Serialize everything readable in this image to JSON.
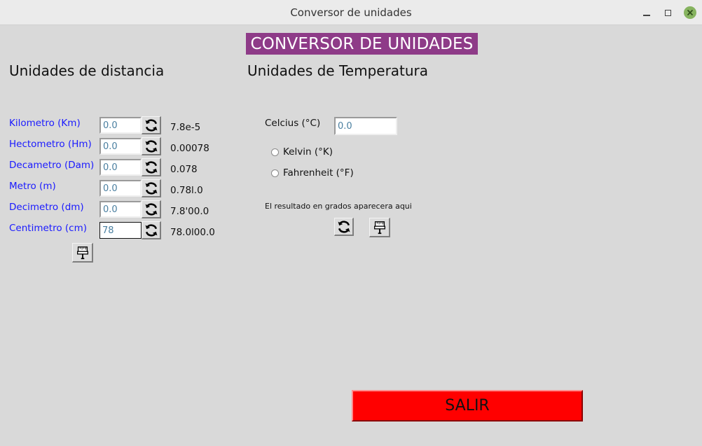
{
  "window": {
    "title": "Conversor de unidades"
  },
  "banner": "CONVERSOR DE UNIDADES",
  "distance": {
    "title": "Unidades de distancia",
    "rows": [
      {
        "label": "Kilometro (Km)",
        "value": "0.0",
        "result": "7.8e-5"
      },
      {
        "label": "Hectometro (Hm)",
        "value": "0.0",
        "result": "0.00078"
      },
      {
        "label": "Decametro (Dam)",
        "value": "0.0",
        "result": "0.078"
      },
      {
        "label": "Metro (m)",
        "value": "0.0",
        "result": "0.78l.0"
      },
      {
        "label": "Decimetro (dm)",
        "value": "0.0",
        "result": "7.8'00.0"
      },
      {
        "label": "Centimetro (cm)",
        "value": "78",
        "result": "78.0l00.0"
      }
    ]
  },
  "temperature": {
    "title": "Unidades de Temperatura",
    "celsius_label": "Celcius (°C)",
    "celsius_value": "0.0",
    "options": [
      "Kelvin (°K)",
      "Fahrenheit (°F)"
    ],
    "result_note": "El resultado en grados aparecera aqui"
  },
  "exit_label": "SALIR",
  "icons": {
    "refresh": "refresh-icon",
    "clear": "brush-icon"
  }
}
